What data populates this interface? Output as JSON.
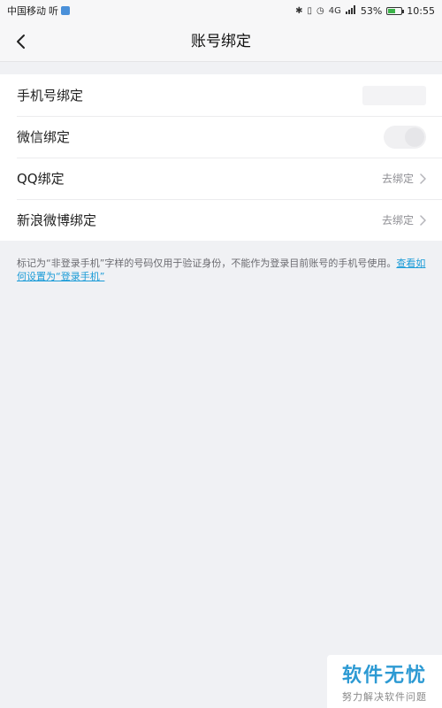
{
  "status_bar": {
    "carrier": "中国移动",
    "carrier_suffix": "听",
    "network": "4G",
    "battery_percent": "53%",
    "battery_level": 0.53,
    "time": "10:55"
  },
  "nav": {
    "title": "账号绑定",
    "back_icon": "chevron-left-icon"
  },
  "bindings": [
    {
      "label": "手机号绑定",
      "status": "",
      "type": "masked"
    },
    {
      "label": "微信绑定",
      "status": "",
      "type": "toggle"
    },
    {
      "label": "QQ绑定",
      "status": "去绑定",
      "type": "link"
    },
    {
      "label": "新浪微博绑定",
      "status": "去绑定",
      "type": "link"
    }
  ],
  "note": {
    "text": "标记为“非登录手机”字样的号码仅用于验证身份，不能作为登录目前账号的手机号使用。",
    "link": "查看如何设置为“登录手机”"
  },
  "watermark": {
    "main": "软件无忧",
    "sub": "努力解决软件问题"
  },
  "colors": {
    "accent": "#1a9bd7",
    "background": "#f0f1f4",
    "watermark": "#2d9ad3"
  }
}
